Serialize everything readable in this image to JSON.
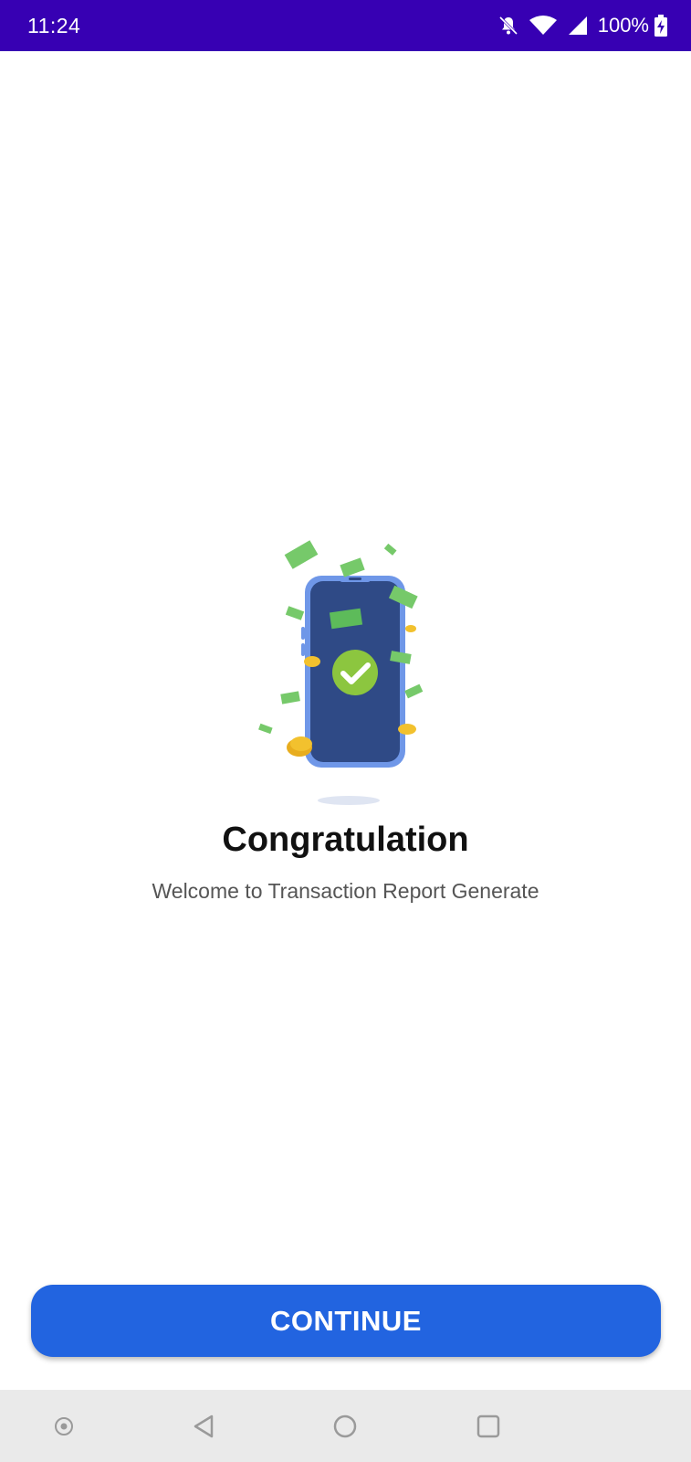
{
  "status_bar": {
    "time": "11:24",
    "battery": "100%",
    "icons": [
      "bell-off-icon",
      "wifi-icon",
      "signal-icon",
      "battery-charging-icon"
    ]
  },
  "illustration": {
    "icon": "phone-success-with-money-icon",
    "colors": {
      "phone_body": "#2f4a86",
      "phone_frame": "#6f97e8",
      "check": "#8cc63f",
      "money": "#76c96a",
      "coin": "#f2c12e"
    }
  },
  "content": {
    "title": "Congratulation",
    "subtitle": "Welcome to Transaction Report Generate"
  },
  "actions": {
    "continue_label": "CONTINUE",
    "accent": "#2264e0"
  },
  "nav_bar": {
    "icons": [
      "assistant-dot-icon",
      "back-icon",
      "home-icon",
      "recents-icon"
    ]
  }
}
